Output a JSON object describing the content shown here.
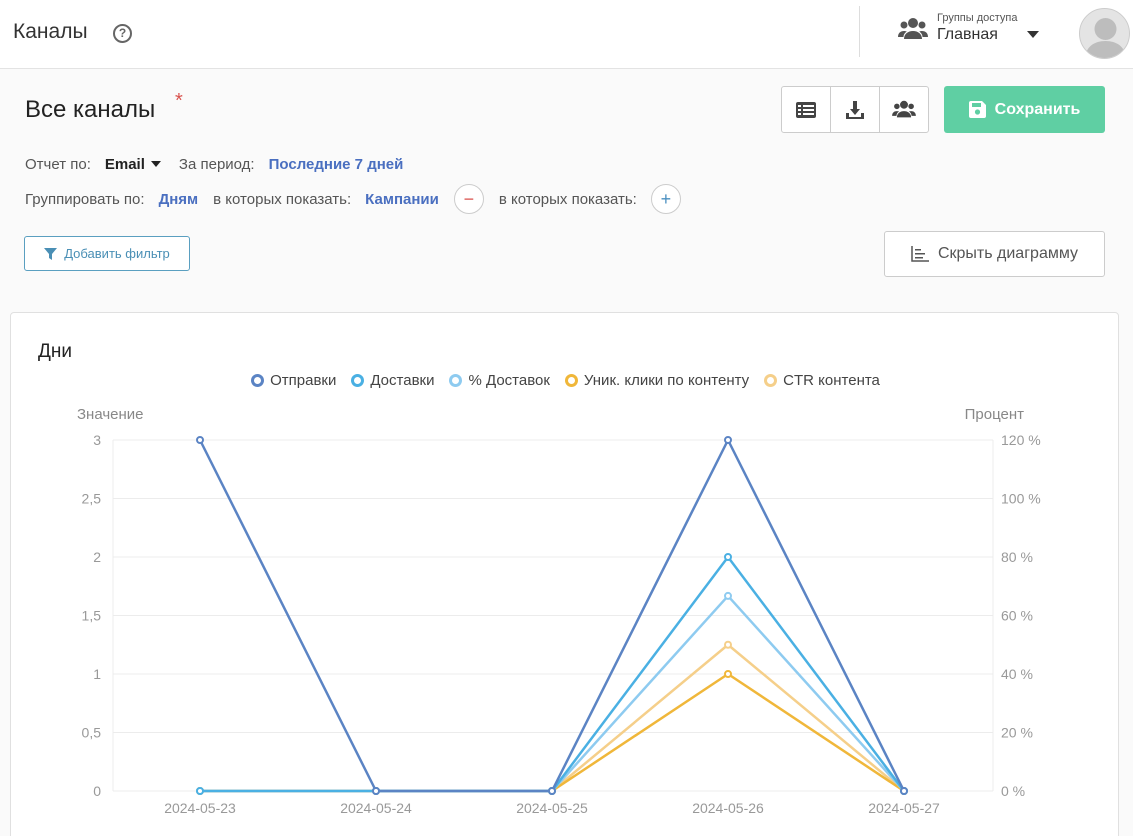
{
  "topbar": {
    "title": "Каналы",
    "help_glyph": "?",
    "access_caption": "Группы доступа",
    "access_value": "Главная"
  },
  "header": {
    "title": "Все каналы",
    "asterisk": "*",
    "save_label": "Сохранить"
  },
  "report": {
    "report_by_label": "Отчет по:",
    "report_by_value": "Email",
    "period_label": "За период:",
    "period_value": "Последние 7 дней",
    "group_by_label": "Группировать по:",
    "group_by_value": "Дням",
    "show_label_1": "в которых показать:",
    "show_value_1": "Кампании",
    "show_label_2": "в которых показать:",
    "minus_glyph": "−",
    "plus_glyph": "+"
  },
  "buttons": {
    "add_filter": "Добавить фильтр",
    "hide_chart": "Скрыть диаграмму"
  },
  "colors": {
    "save_green": "#5fcfa3",
    "link_blue": "#4a6fc0",
    "series_sends": "#5b84c4",
    "series_deliveries": "#4ab0e3",
    "series_pct_deliveries": "#8ecbf0",
    "series_unique_clicks": "#f0b73a",
    "series_ctr": "#f5cf8a"
  },
  "chart_data": {
    "type": "line",
    "title": "Дни",
    "left_axis_label": "Значение",
    "right_axis_label": "Процент",
    "x": [
      "2024-05-23",
      "2024-05-24",
      "2024-05-25",
      "2024-05-26",
      "2024-05-27"
    ],
    "left_ticks": [
      "0",
      "0,5",
      "1",
      "1,5",
      "2",
      "2,5",
      "3"
    ],
    "right_ticks": [
      "0 %",
      "20 %",
      "40 %",
      "60 %",
      "80 %",
      "100 %",
      "120 %"
    ],
    "ylim_left": [
      0,
      3
    ],
    "ylim_right": [
      0,
      120
    ],
    "grid": true,
    "legend_position": "top-center",
    "series": [
      {
        "name": "Отправки",
        "axis": "left",
        "color": "#5b84c4",
        "values": [
          3,
          0,
          0,
          3,
          0
        ]
      },
      {
        "name": "Доставки",
        "axis": "left",
        "color": "#4ab0e3",
        "values": [
          0,
          0,
          0,
          2,
          0
        ]
      },
      {
        "name": "% Доставок",
        "axis": "right",
        "color": "#8ecbf0",
        "values": [
          0,
          0,
          0,
          66.7,
          0
        ]
      },
      {
        "name": "Уник. клики по контенту",
        "axis": "left",
        "color": "#f0b73a",
        "values": [
          0,
          0,
          0,
          1,
          0
        ]
      },
      {
        "name": "CTR контента",
        "axis": "right",
        "color": "#f5cf8a",
        "values": [
          0,
          0,
          0,
          50,
          0
        ]
      }
    ]
  }
}
